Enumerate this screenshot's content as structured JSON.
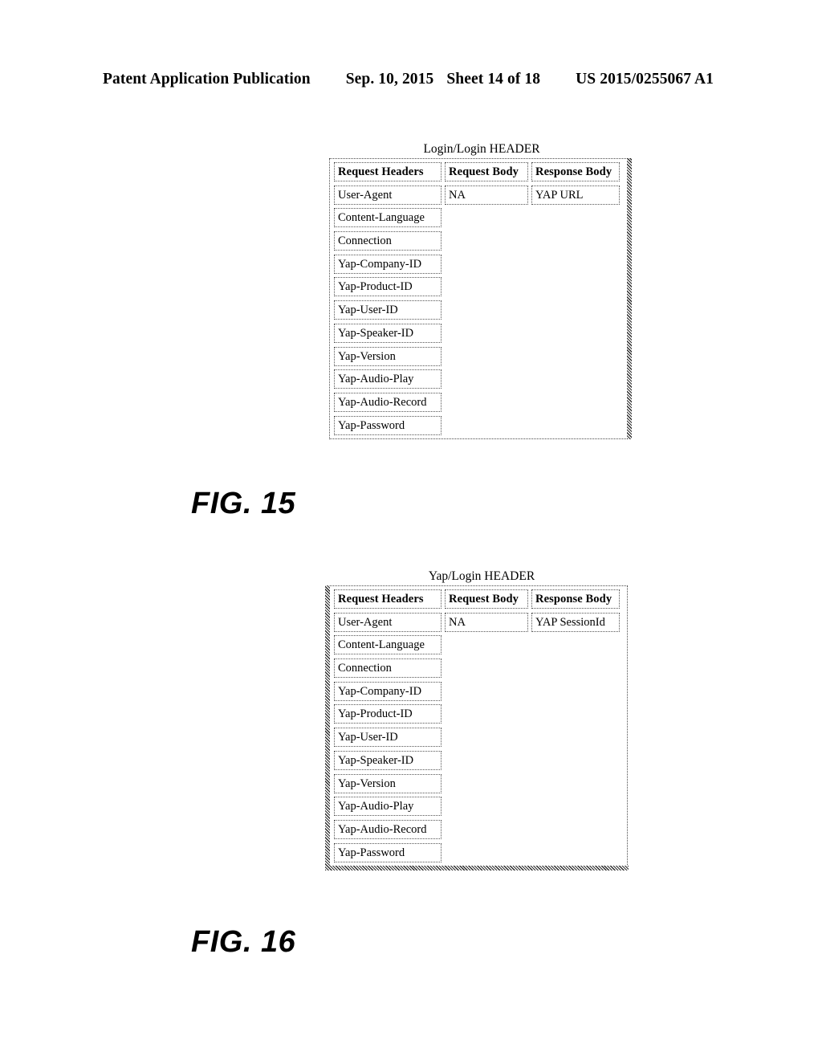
{
  "page": {
    "header": {
      "publication": "Patent Application Publication",
      "date": "Sep. 10, 2015",
      "sheet": "Sheet 14 of 18",
      "patent_number": "US 2015/0255067 A1"
    },
    "background_color": "#ffffff",
    "ink_color": "#000000"
  },
  "figures": [
    {
      "id": "fig-15",
      "caption": "FIG. 15",
      "title": "Login/Login HEADER",
      "table": {
        "columns": [
          "Request Headers",
          "Request Body",
          "Response Body"
        ],
        "rows": [
          {
            "request_header": "User-Agent",
            "request_body": "NA",
            "response_body": "YAP URL"
          },
          {
            "request_header": "Content-Language",
            "request_body": "",
            "response_body": ""
          },
          {
            "request_header": "Connection",
            "request_body": "",
            "response_body": ""
          },
          {
            "request_header": "Yap-Company-ID",
            "request_body": "",
            "response_body": ""
          },
          {
            "request_header": "Yap-Product-ID",
            "request_body": "",
            "response_body": ""
          },
          {
            "request_header": "Yap-User-ID",
            "request_body": "",
            "response_body": ""
          },
          {
            "request_header": "Yap-Speaker-ID",
            "request_body": "",
            "response_body": ""
          },
          {
            "request_header": "Yap-Version",
            "request_body": "",
            "response_body": ""
          },
          {
            "request_header": "Yap-Audio-Play",
            "request_body": "",
            "response_body": ""
          },
          {
            "request_header": "Yap-Audio-Record",
            "request_body": "",
            "response_body": ""
          },
          {
            "request_header": "Yap-Password",
            "request_body": "",
            "response_body": ""
          }
        ]
      }
    },
    {
      "id": "fig-16",
      "caption": "FIG. 16",
      "title": "Yap/Login HEADER",
      "table": {
        "columns": [
          "Request Headers",
          "Request Body",
          "Response Body"
        ],
        "rows": [
          {
            "request_header": "User-Agent",
            "request_body": "NA",
            "response_body": "YAP SessionId"
          },
          {
            "request_header": "Content-Language",
            "request_body": "",
            "response_body": ""
          },
          {
            "request_header": "Connection",
            "request_body": "",
            "response_body": ""
          },
          {
            "request_header": "Yap-Company-ID",
            "request_body": "",
            "response_body": ""
          },
          {
            "request_header": "Yap-Product-ID",
            "request_body": "",
            "response_body": ""
          },
          {
            "request_header": "Yap-User-ID",
            "request_body": "",
            "response_body": ""
          },
          {
            "request_header": "Yap-Speaker-ID",
            "request_body": "",
            "response_body": ""
          },
          {
            "request_header": "Yap-Version",
            "request_body": "",
            "response_body": ""
          },
          {
            "request_header": "Yap-Audio-Play",
            "request_body": "",
            "response_body": ""
          },
          {
            "request_header": "Yap-Audio-Record",
            "request_body": "",
            "response_body": ""
          },
          {
            "request_header": "Yap-Password",
            "request_body": "",
            "response_body": ""
          }
        ]
      }
    }
  ]
}
